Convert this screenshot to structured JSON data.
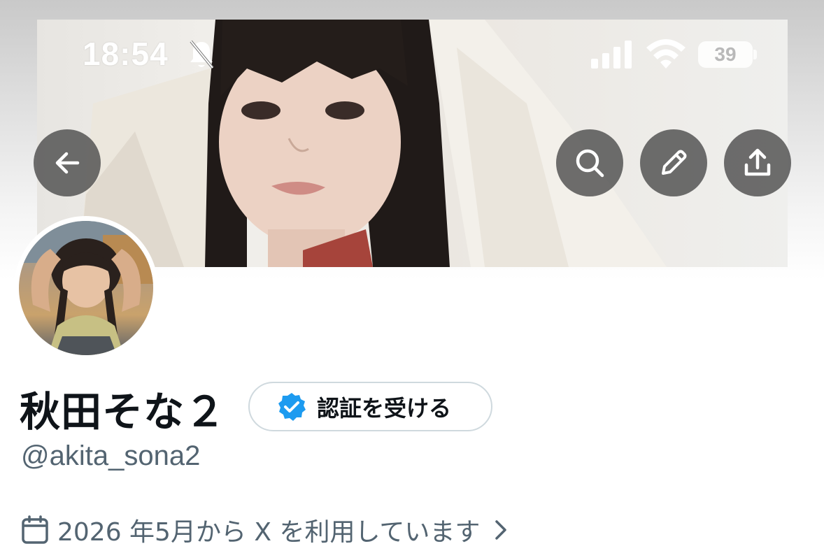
{
  "status_bar": {
    "time": "18:54",
    "battery": "39",
    "icons": [
      "bell-slash-icon",
      "cellular-signal-icon",
      "wifi-icon",
      "battery-icon"
    ]
  },
  "header": {
    "buttons": [
      "back-arrow-icon",
      "search-icon",
      "pencil-icon",
      "share-icon"
    ]
  },
  "profile": {
    "display_name": "秋田そな２",
    "verify_label": "認証を受ける",
    "handle": "@akita_sona2",
    "joined": "2026 年5月から X を利用しています"
  },
  "colors": {
    "verified_blue": "#1d9bf0",
    "secondary_text": "#536471",
    "primary_text": "#0f1419",
    "border": "#cfd9de"
  }
}
